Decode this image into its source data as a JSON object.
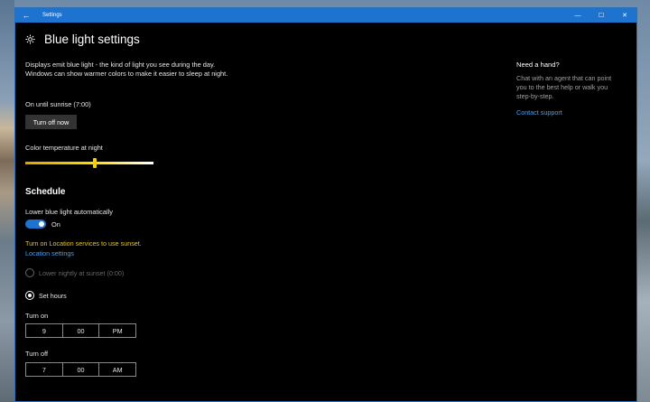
{
  "window": {
    "title": "Settings",
    "back_glyph": "←",
    "minimize_glyph": "—",
    "maximize_glyph": "☐",
    "close_glyph": "✕"
  },
  "header": {
    "title": "Blue light settings",
    "icon": "gear-icon"
  },
  "description": "Displays emit blue light - the kind of light you see during the day. Windows can show warmer colors to make it easier to sleep at night.",
  "status": "On until sunrise (7:00)",
  "turn_off_button": "Turn off now",
  "color_temperature": {
    "label": "Color temperature at night",
    "value": 0.54,
    "accent": "#f5d200"
  },
  "schedule": {
    "heading": "Schedule",
    "toggle_label": "Lower blue light automatically",
    "toggle_state": "On",
    "warning": "Turn on Location services to use sunset.",
    "location_link": "Location settings",
    "option_sunset": "Lower nightly at sunset (0:00)",
    "option_set_hours": "Set hours",
    "turn_on": {
      "label": "Turn on",
      "hour": "9",
      "minute": "00",
      "ampm": "PM"
    },
    "turn_off": {
      "label": "Turn off",
      "hour": "7",
      "minute": "00",
      "ampm": "AM"
    }
  },
  "help": {
    "heading": "Need a hand?",
    "text": "Chat with an agent that can point you to the best help or walk you step-by-step.",
    "link": "Contact support"
  },
  "colors": {
    "accent": "#1e73cf",
    "link": "#4aa0ec",
    "warning": "#e0c43a"
  }
}
